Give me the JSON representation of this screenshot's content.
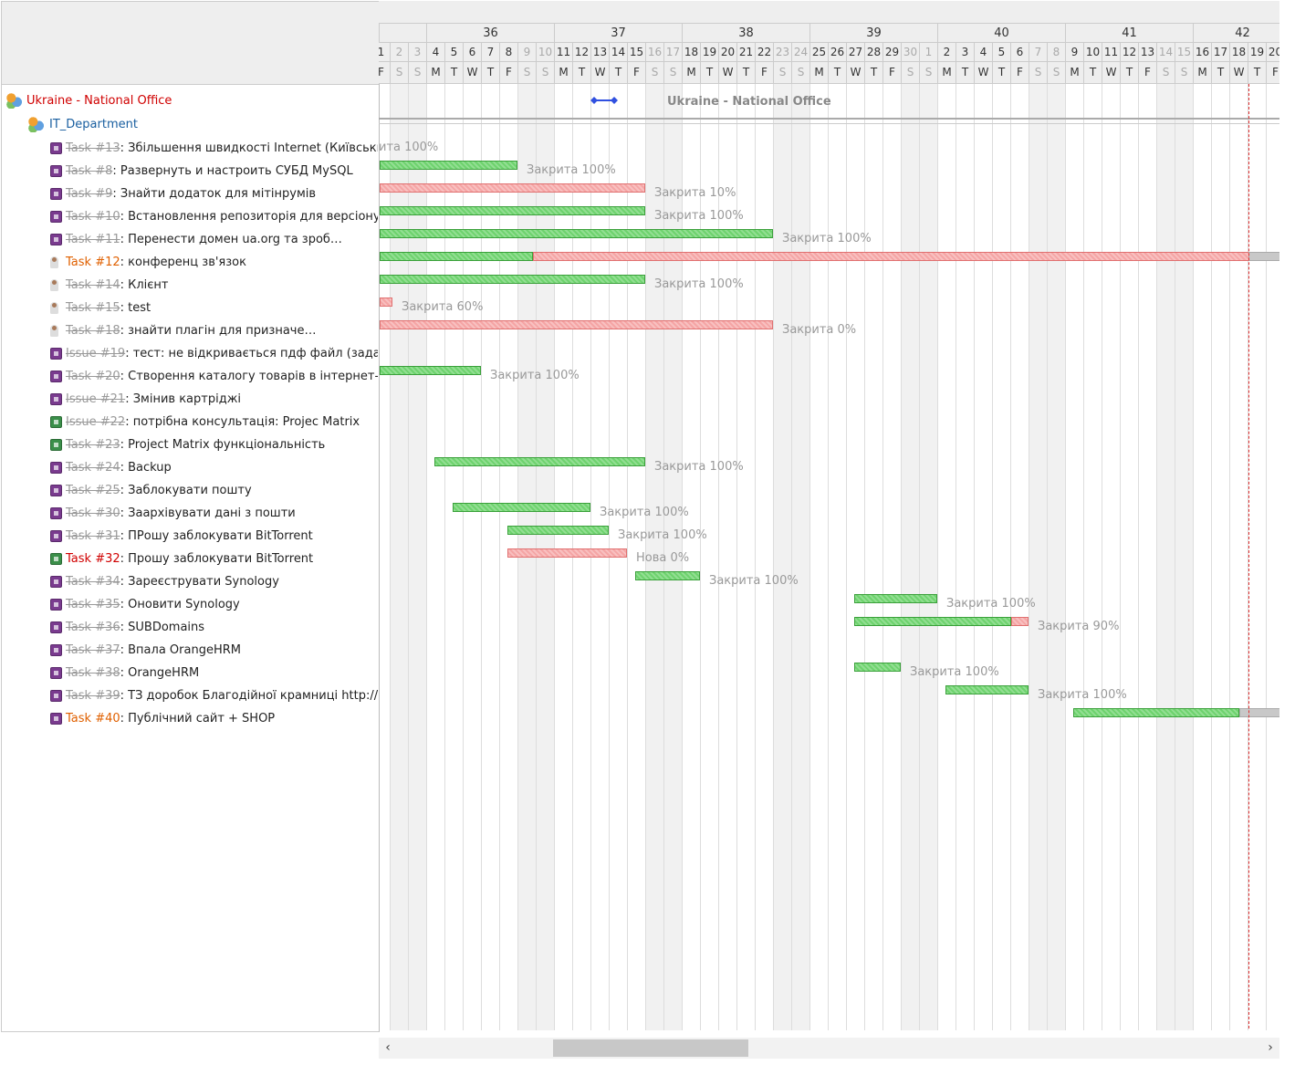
{
  "tree": {
    "project": "Ukraine - National Office",
    "subproject": "IT_Department",
    "rows": [
      {
        "num": "Task #13",
        "title": "Збільшення швидкості Internet (Київськи…",
        "done": true,
        "icon": "task-icon"
      },
      {
        "num": "Task #8",
        "title": "Развернуть и настроить СУБД MySQL",
        "done": true,
        "icon": "task-icon"
      },
      {
        "num": "Task #9",
        "title": "Знайти додаток для мітінрумів",
        "done": true,
        "icon": "task-icon"
      },
      {
        "num": "Task #10",
        "title": "Встановлення репозиторія для версіону…",
        "done": true,
        "icon": "task-icon"
      },
      {
        "num": "Task #11",
        "title": "Перенести домен  ua.org та зроб…",
        "done": true,
        "icon": "task-icon"
      },
      {
        "num": "Task #12",
        "title": "конференц зв'язок",
        "done": false,
        "icon": "person-icon",
        "color": "#e06000"
      },
      {
        "num": "Task #14",
        "title": "Клієнт",
        "done": true,
        "icon": "person-icon"
      },
      {
        "num": "Task #15",
        "title": "test",
        "done": true,
        "icon": "person-icon"
      },
      {
        "num": "Task #18",
        "title": "знайти плагін для призначе…",
        "done": true,
        "icon": "person-icon"
      },
      {
        "num": "Issue #19",
        "title": "тест: не відкривається пдф файл (зада…",
        "done": true,
        "icon": "task-icon"
      },
      {
        "num": "Task #20",
        "title": "Створення каталогу товарів в інтернет-…",
        "done": true,
        "icon": "task-icon"
      },
      {
        "num": "Issue #21",
        "title": "Змінив картріджі",
        "done": true,
        "icon": "task-icon"
      },
      {
        "num": "Issue #22",
        "title": "потрібна консультація: Projec Matrix",
        "done": true,
        "icon": "task-green-icon"
      },
      {
        "num": "Task #23",
        "title": "Project Matrix функціональність",
        "done": true,
        "icon": "task-green-icon"
      },
      {
        "num": "Task #24",
        "title": "Backup",
        "done": true,
        "icon": "task-icon"
      },
      {
        "num": "Task #25",
        "title": "Заблокувати пошту",
        "done": true,
        "icon": "task-icon"
      },
      {
        "num": "Task #30",
        "title": "Заархівувати дані з пошти",
        "done": true,
        "icon": "task-icon"
      },
      {
        "num": "Task #31",
        "title": "ПРошу заблокувати BitTorrent",
        "done": true,
        "icon": "task-icon"
      },
      {
        "num": "Task #32",
        "title": "Прошу заблокувати BitTorrent",
        "done": false,
        "icon": "task-green-icon",
        "color": "#d00000"
      },
      {
        "num": "Task #34",
        "title": "Зареєструвати Synology",
        "done": true,
        "icon": "task-icon"
      },
      {
        "num": "Task #35",
        "title": "Оновити Synology",
        "done": true,
        "icon": "task-icon"
      },
      {
        "num": "Task #36",
        "title": "SUBDomains",
        "done": true,
        "icon": "task-icon"
      },
      {
        "num": "Task #37",
        "title": "Впала OrangeHRM",
        "done": true,
        "icon": "task-icon"
      },
      {
        "num": "Task #38",
        "title": "OrangeHRM",
        "done": true,
        "icon": "task-icon"
      },
      {
        "num": "Task #39",
        "title": "ТЗ доробок Благодійної крамниці http://…",
        "done": true,
        "icon": "task-icon"
      },
      {
        "num": "Task #40",
        "title": "Публічний сайт + SHOP",
        "done": false,
        "icon": "task-icon",
        "color": "#e06000"
      }
    ]
  },
  "timeline": {
    "weeks": [
      "36",
      "37",
      "38",
      "39",
      "40",
      "41",
      "42"
    ],
    "days": [
      "1",
      "2",
      "3",
      "4",
      "5",
      "6",
      "7",
      "8",
      "9",
      "10",
      "11",
      "12",
      "13",
      "14",
      "15",
      "16",
      "17",
      "18",
      "19",
      "20",
      "21",
      "22",
      "23",
      "24",
      "25",
      "26",
      "27",
      "28",
      "29",
      "30",
      "1",
      "2",
      "3",
      "4",
      "5",
      "6",
      "7",
      "8",
      "9",
      "10",
      "11",
      "12",
      "13",
      "14",
      "15",
      "16",
      "17",
      "18",
      "19",
      "20"
    ],
    "weekday_letters": [
      "F",
      "S",
      "S",
      "M",
      "T",
      "W",
      "T",
      "F",
      "S",
      "S",
      "M",
      "T",
      "W",
      "T",
      "F",
      "S",
      "S",
      "M",
      "T",
      "W",
      "T",
      "F",
      "S",
      "S",
      "M",
      "T",
      "W",
      "T",
      "F",
      "S",
      "S",
      "M",
      "T",
      "W",
      "T",
      "F",
      "S",
      "S",
      "M",
      "T",
      "W",
      "T",
      "F",
      "S",
      "S",
      "M",
      "T",
      "W",
      "T",
      "F"
    ],
    "project_label": "Ukraine - National Office"
  },
  "bars": [
    {
      "row": 0,
      "start": null,
      "end": null,
      "label": "ита 100%",
      "status": "done",
      "done_pct": 100
    },
    {
      "row": 1,
      "start": 0,
      "end": 7,
      "label": "Закрита 100%",
      "status": "done",
      "done_pct": 100
    },
    {
      "row": 2,
      "start": 0,
      "end": 14,
      "label": "Закрита 10%",
      "status": "late",
      "done_pct": 10
    },
    {
      "row": 3,
      "start": 0,
      "end": 14,
      "label": "Закрита 100%",
      "status": "done",
      "done_pct": 100
    },
    {
      "row": 4,
      "start": 0,
      "end": 21,
      "label": "Закрита 100%",
      "status": "done",
      "done_pct": 100
    },
    {
      "row": 5,
      "start": 0,
      "end": 49,
      "label": "",
      "status": "mixed",
      "done_pct": 17
    },
    {
      "row": 6,
      "start": 0,
      "end": 14,
      "label": "Закрита 100%",
      "status": "done",
      "done_pct": 100
    },
    {
      "row": 7,
      "start": 0,
      "end": 0,
      "label": "Закрита 60%",
      "status": "late",
      "done_pct": 60
    },
    {
      "row": 8,
      "start": 0,
      "end": 21,
      "label": "Закрита 0%",
      "status": "late",
      "done_pct": 0
    },
    {
      "row": 10,
      "start": 0,
      "end": 5,
      "label": "Закрита 100%",
      "status": "done",
      "done_pct": 100
    },
    {
      "row": 14,
      "start": 3,
      "end": 14,
      "label": "Закрита 100%",
      "status": "done",
      "done_pct": 100
    },
    {
      "row": 16,
      "start": 4,
      "end": 11,
      "label": "Закрита 100%",
      "status": "done",
      "done_pct": 100
    },
    {
      "row": 17,
      "start": 7,
      "end": 12,
      "label": "Закрита 100%",
      "status": "done",
      "done_pct": 100
    },
    {
      "row": 18,
      "start": 7,
      "end": 13,
      "label": "Нова 0%",
      "status": "late",
      "done_pct": 0
    },
    {
      "row": 19,
      "start": 14,
      "end": 17,
      "label": "Закрита 100%",
      "status": "done",
      "done_pct": 100
    },
    {
      "row": 20,
      "start": 26,
      "end": 30,
      "label": "Закрита 100%",
      "status": "done",
      "done_pct": 100
    },
    {
      "row": 21,
      "start": 26,
      "end": 35,
      "label": "Закрита 90%",
      "status": "mixed",
      "done_pct": 90
    },
    {
      "row": 23,
      "start": 26,
      "end": 28,
      "label": "Закрита 100%",
      "status": "done",
      "done_pct": 100
    },
    {
      "row": 24,
      "start": 31,
      "end": 35,
      "label": "Закрита 100%",
      "status": "done",
      "done_pct": 100
    },
    {
      "row": 25,
      "start": 38,
      "end": 49,
      "label": "",
      "status": "done-gray",
      "done_pct": 100
    }
  ],
  "scrollbar": {
    "left_arrow": "‹",
    "right_arrow": "›"
  }
}
